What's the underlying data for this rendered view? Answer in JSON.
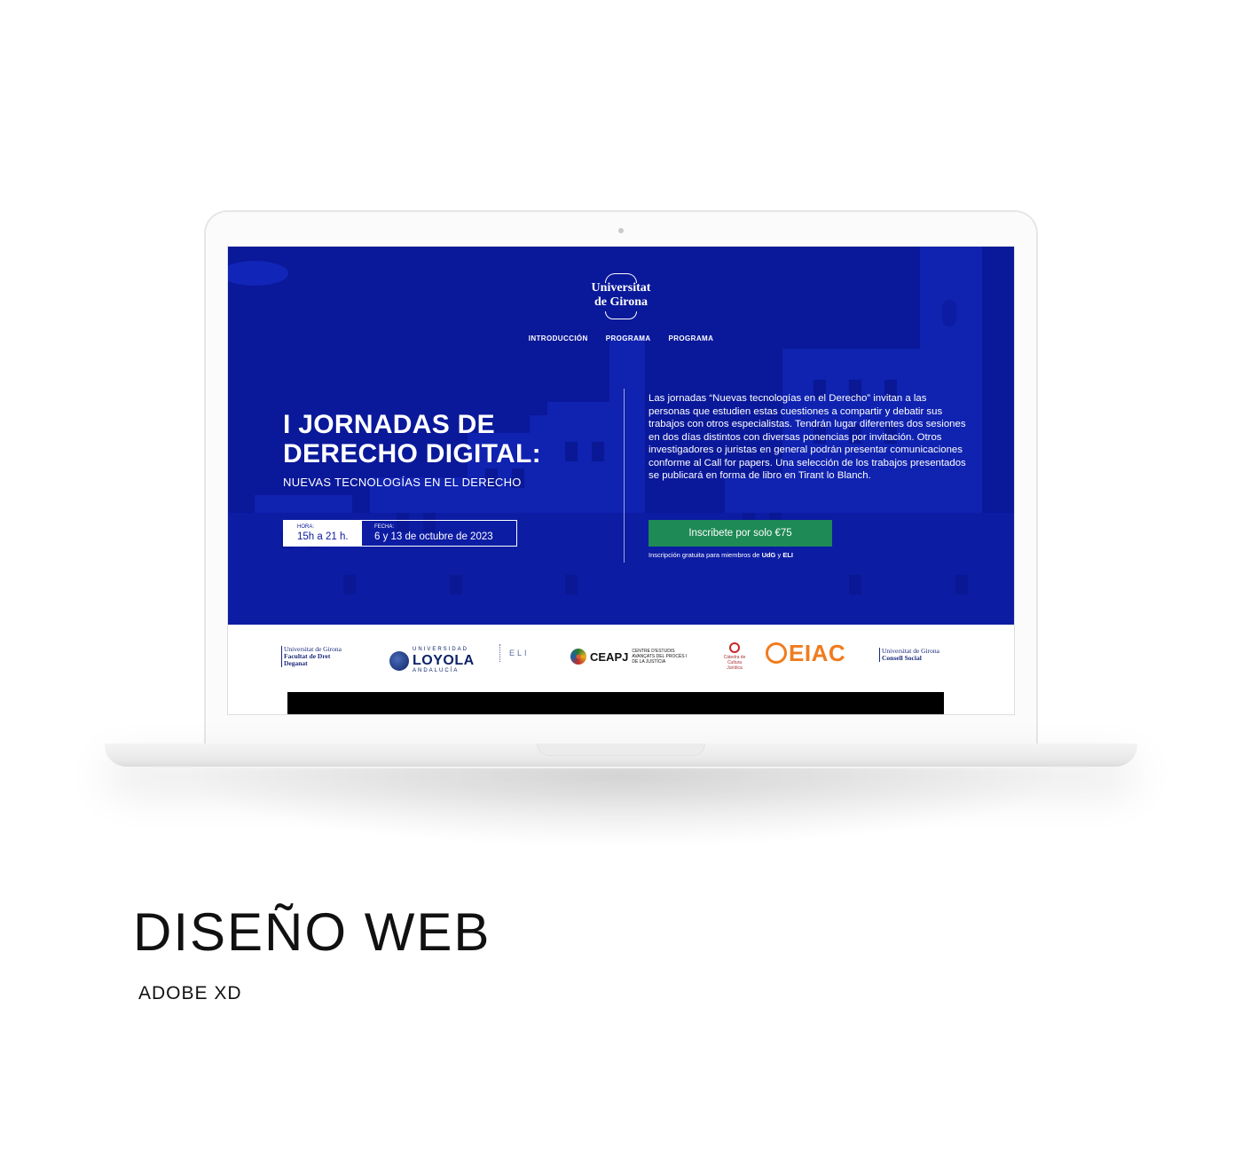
{
  "website": {
    "logo": {
      "line1": "Universitat",
      "line2": "de Girona"
    },
    "nav": [
      "INTRODUCCIÓN",
      "PROGRAMA",
      "PROGRAMA"
    ],
    "hero": {
      "title_line1": "I JORNADAS DE",
      "title_line2": "DERECHO DIGITAL:",
      "subtitle": "NUEVAS TECNOLOGÍAS EN EL DERECHO",
      "hora_label": "HORA:",
      "hora_value": "15h a 21 h.",
      "fecha_label": "FECHA:",
      "fecha_value": "6 y 13 de octubre de 2023",
      "description": "Las jornadas “Nuevas tecnologías en el Derecho” invitan a las personas que estudien estas cuestiones a compartir y debatir sus trabajos con otros especialistas. Tendrán lugar diferentes dos sesiones en dos días distintos con diversas ponencias por invitación. Otros investigadores o juristas en general podrán presentar comunicaciones conforme al Call for papers. Una selección de los trabajos presentados se publicará en forma de libro en Tirant lo Blanch.",
      "cta_label": "Inscribete por solo €75",
      "note_prefix": "Inscripción gratuita para miembros de ",
      "note_b1": "UdG",
      "note_mid": " y ",
      "note_b2": "ELI"
    },
    "sponsors": {
      "udg_facultat": {
        "l1": "Universitat de Girona",
        "l2": "Facultat de Dret",
        "l3": "Deganat"
      },
      "loyola": {
        "top": "UNIVERSIDAD",
        "main": "LOYOLA",
        "bottom": "ANDALUCÍA"
      },
      "eli": "ELI",
      "ceapj": {
        "main": "CEAPJ",
        "sub": "CENTRE D'ESTUDIS AVANÇATS DEL PROCÉS I DE LA JUSTÍCIA"
      },
      "ccj": "Càtedra de Cultura Jurídica",
      "eiac": {
        "main": "EIAC"
      },
      "udg_consell": {
        "l1": "Universitat de Girona",
        "l2": "Consell Social"
      }
    },
    "colors": {
      "hero_bg": "#0a189a",
      "cta_bg": "#1e8a55",
      "eiac": "#f07c1e"
    }
  },
  "caption": {
    "title": "DISEÑO WEB",
    "subtitle": "ADOBE XD"
  }
}
